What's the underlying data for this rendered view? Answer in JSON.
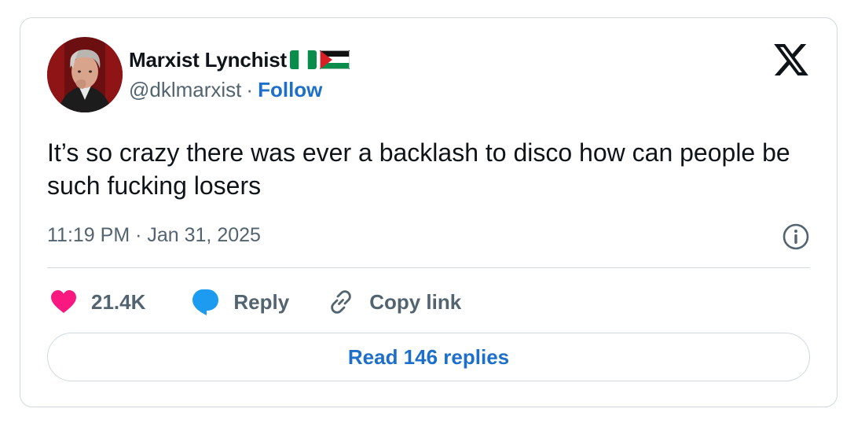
{
  "tweet": {
    "author": {
      "display_name": "Marxist Lynchist",
      "name_flags": [
        "nigeria-flag",
        "palestine-flag"
      ],
      "handle": "@dklmarxist",
      "separator": "·",
      "follow_label": "Follow"
    },
    "text": "It’s so crazy there was ever a backlash to disco how can people be such fucking losers",
    "timestamp": "11:19 PM · Jan 31, 2025",
    "actions": {
      "like_count": "21.4K",
      "reply_label": "Reply",
      "copy_link_label": "Copy link"
    },
    "read_replies_label": "Read 146 replies"
  },
  "icons": {
    "platform_logo": "x-logo-icon",
    "info": "info-icon",
    "like": "heart-icon",
    "reply": "speech-bubble-icon",
    "copy_link": "link-icon"
  },
  "colors": {
    "text": "#0f1419",
    "secondary_text": "#536471",
    "link": "#1d6fc9",
    "like": "#f91880",
    "reply": "#1d9bf0",
    "border": "#cfd9de"
  }
}
